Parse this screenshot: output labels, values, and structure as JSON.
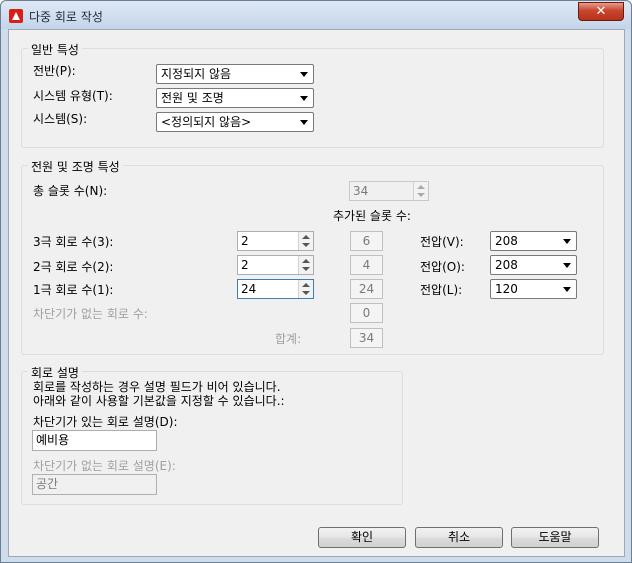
{
  "window": {
    "title": "다중 회로 작성",
    "close_label": "✕"
  },
  "general": {
    "title": "일반 특성",
    "panel_label": "전반(P):",
    "panel_value": "지정되지 않음",
    "system_type_label": "시스템 유형(T):",
    "system_type_value": "전원 및 조명",
    "system_label": "시스템(S):",
    "system_value": "<정의되지 않음>"
  },
  "power": {
    "title": "전원 및 조명 특성",
    "total_slots_label": "총 슬롯 수(N):",
    "total_slots_value": "34",
    "added_slots_header": "추가된 슬롯 수:",
    "rows": [
      {
        "label": "3극 회로 수(3):",
        "value": "2",
        "slots": "6",
        "voltage_label": "전압(V):",
        "voltage_value": "208"
      },
      {
        "label": "2극 회로 수(2):",
        "value": "2",
        "slots": "4",
        "voltage_label": "전압(O):",
        "voltage_value": "208"
      },
      {
        "label": "1극 회로 수(1):",
        "value": "24",
        "slots": "24",
        "voltage_label": "전압(L):",
        "voltage_value": "120"
      }
    ],
    "no_breaker_label": "차단기가 없는 회로 수:",
    "no_breaker_value": "0",
    "total_label": "합계:",
    "total_value": "34"
  },
  "description": {
    "title": "회로 설명",
    "info_line1": "회로를 작성하는 경우 설명 필드가 비어 있습니다.",
    "info_line2": "아래와 같이 사용할 기본값을 지정할 수 있습니다.:",
    "with_breaker_label": "차단기가 있는 회로 설명(D):",
    "with_breaker_value": "예비용",
    "without_breaker_label": "차단기가 없는 회로 설명(E):",
    "without_breaker_value": "공간"
  },
  "buttons": {
    "ok": "확인",
    "cancel": "취소",
    "help": "도움말"
  }
}
